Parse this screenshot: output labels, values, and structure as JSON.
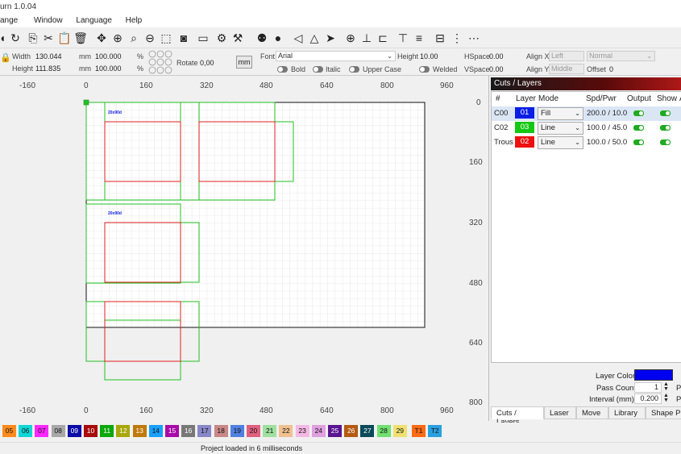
{
  "titlebar": {
    "title": "urn 1.0.04"
  },
  "menu": [
    "ange",
    "Window",
    "Language",
    "Help"
  ],
  "props": {
    "width_label": "Width",
    "width_value": "130.044",
    "width_unit": "mm",
    "width_pct": "100.000",
    "pct": "%",
    "height_label": "Height",
    "height_value": "111.835",
    "height_unit": "mm",
    "height_pct": "100.000",
    "rotate_label": "Rotate",
    "rotate_value": "0,00",
    "mm_button": "mm",
    "font_label": "Font",
    "font_value": "Arial",
    "text_height_label": "Height",
    "text_height_value": "10.00",
    "hspace_label": "HSpace",
    "hspace_value": "0.00",
    "vspace_label": "VSpace",
    "vspace_value": "0.00",
    "alignx_label": "Align X",
    "alignx_value": "Left",
    "aligny_label": "Align Y",
    "aligny_value": "Middle",
    "normal_value": "Normal",
    "offset_label": "Offset",
    "offset_value": "0",
    "bold": "Bold",
    "italic": "Italic",
    "upper": "Upper Case",
    "welded": "Welded"
  },
  "rulers": {
    "top": [
      "-160",
      "0",
      "160",
      "320",
      "480",
      "640",
      "800",
      "960"
    ],
    "bottom": [
      "-160",
      "0",
      "160",
      "320",
      "480",
      "640",
      "800",
      "960"
    ],
    "right": [
      "0",
      "160",
      "320",
      "480",
      "640",
      "800"
    ]
  },
  "canvas": {
    "label_text": "20x90d"
  },
  "panel": {
    "title": "Cuts / Layers",
    "headers": [
      "#",
      "Layer",
      "Mode",
      "Spd/Pwr",
      "Output",
      "Show",
      "A"
    ],
    "rows": [
      {
        "name": "C00",
        "layer": "01",
        "color": "#0a1ee6",
        "mode": "Fill",
        "spdpwr": "200.0 / 10.0"
      },
      {
        "name": "C02",
        "layer": "03",
        "color": "#14c814",
        "mode": "Line",
        "spdpwr": "100.0 / 45.0"
      },
      {
        "name": "Trous",
        "layer": "02",
        "color": "#ee1010",
        "mode": "Line",
        "spdpwr": "100.0 / 50.0"
      }
    ],
    "layer_color_label": "Layer Color",
    "layer_color": "#0000f0",
    "pass_count_label": "Pass Count",
    "pass_count_value": "1",
    "pass_suffix": "P",
    "interval_label": "Interval (mm)",
    "interval_value": "0.200",
    "interval_suffix": "P",
    "tabs": [
      "Cuts / Layers",
      "Laser",
      "Move",
      "Library",
      "Shape Prop"
    ]
  },
  "palette": [
    {
      "label": "05",
      "color": "#ff8a1c"
    },
    {
      "label": "06",
      "color": "#11d6d6"
    },
    {
      "label": "07",
      "color": "#ff28ff"
    },
    {
      "label": "08",
      "color": "#a8a8a8"
    },
    {
      "label": "09",
      "color": "#0b0ba8"
    },
    {
      "label": "10",
      "color": "#a80b0b"
    },
    {
      "label": "11",
      "color": "#0ba80b"
    },
    {
      "label": "12",
      "color": "#a8a80b"
    },
    {
      "label": "13",
      "color": "#c07a0b"
    },
    {
      "label": "14",
      "color": "#18a0ff"
    },
    {
      "label": "15",
      "color": "#a80ba8"
    },
    {
      "label": "16",
      "color": "#787878"
    },
    {
      "label": "17",
      "color": "#8888c8"
    },
    {
      "label": "18",
      "color": "#c88888"
    },
    {
      "label": "19",
      "color": "#5080e0"
    },
    {
      "label": "20",
      "color": "#e06080"
    },
    {
      "label": "21",
      "color": "#a0e0a0"
    },
    {
      "label": "22",
      "color": "#f0c090"
    },
    {
      "label": "23",
      "color": "#f4b8e4"
    },
    {
      "label": "24",
      "color": "#e0a0e0"
    },
    {
      "label": "25",
      "color": "#5a1490"
    },
    {
      "label": "26",
      "color": "#b45a14"
    },
    {
      "label": "27",
      "color": "#0a4a5a"
    },
    {
      "label": "28",
      "color": "#70e070"
    },
    {
      "label": "29",
      "color": "#f0e070"
    },
    {
      "label": "T1",
      "color": "#ff6a14"
    },
    {
      "label": "T2",
      "color": "#2aa0e0"
    }
  ],
  "status": {
    "text": "Project loaded in 6 milliseconds"
  }
}
